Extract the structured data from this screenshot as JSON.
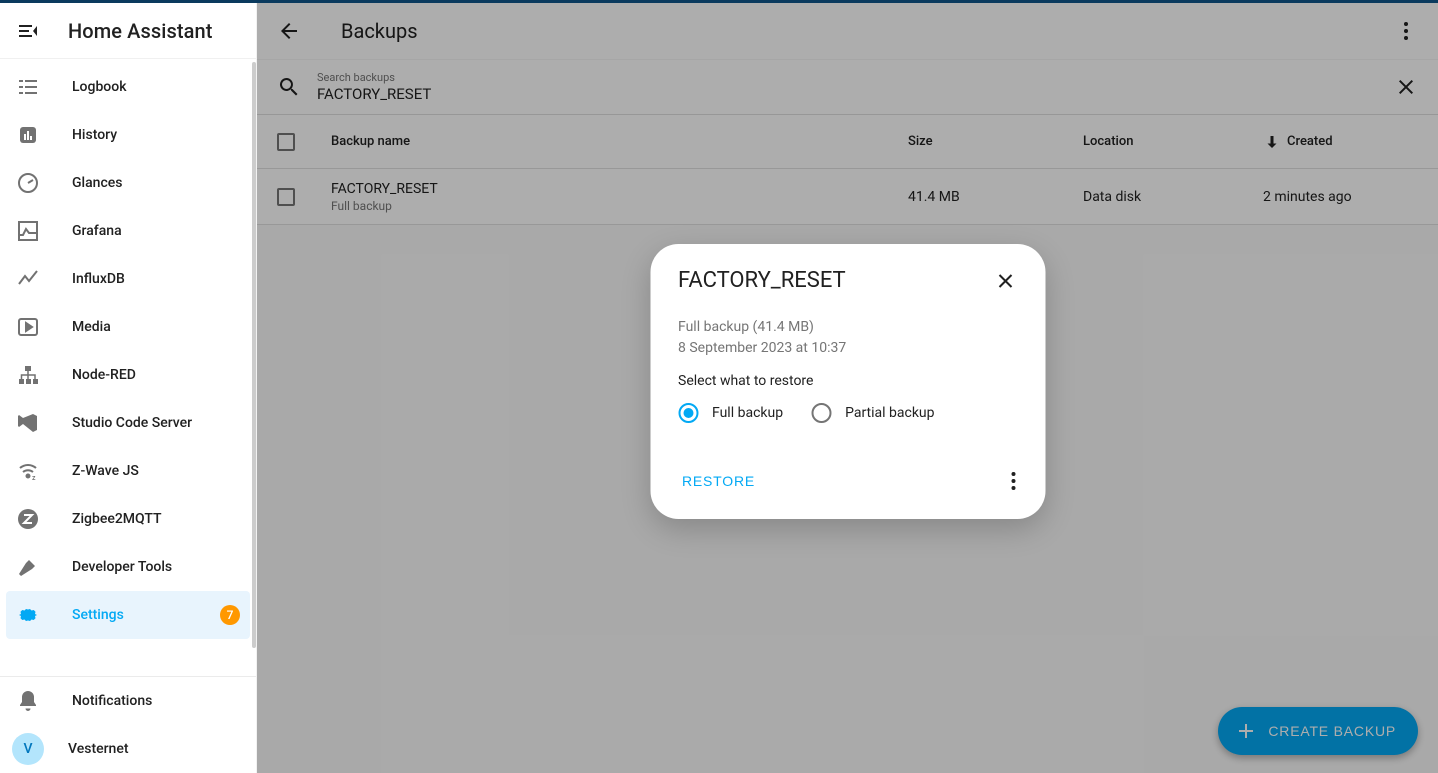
{
  "app": {
    "title": "Home Assistant"
  },
  "sidebar": {
    "items": [
      {
        "label": "Logbook"
      },
      {
        "label": "History"
      },
      {
        "label": "Glances"
      },
      {
        "label": "Grafana"
      },
      {
        "label": "InfluxDB"
      },
      {
        "label": "Media"
      },
      {
        "label": "Node-RED"
      },
      {
        "label": "Studio Code Server"
      },
      {
        "label": "Z-Wave JS"
      },
      {
        "label": "Zigbee2MQTT"
      },
      {
        "label": "Developer Tools"
      },
      {
        "label": "Settings",
        "active": true,
        "badge": "7"
      }
    ],
    "notifications_label": "Notifications",
    "user": {
      "initial": "V",
      "name": "Vesternet"
    }
  },
  "page": {
    "title": "Backups",
    "search": {
      "label": "Search backups",
      "value": "FACTORY_RESET"
    },
    "columns": {
      "name": "Backup name",
      "size": "Size",
      "location": "Location",
      "created": "Created"
    },
    "rows": [
      {
        "name": "FACTORY_RESET",
        "sub": "Full backup",
        "size": "41.4 MB",
        "location": "Data disk",
        "created": "2 minutes ago"
      }
    ],
    "create_label": "CREATE BACKUP"
  },
  "dialog": {
    "title": "FACTORY_RESET",
    "info_line1": "Full backup (41.4 MB)",
    "info_line2": "8 September 2023 at 10:37",
    "select_label": "Select what to restore",
    "option_full": "Full backup",
    "option_partial": "Partial backup",
    "restore_label": "RESTORE"
  }
}
